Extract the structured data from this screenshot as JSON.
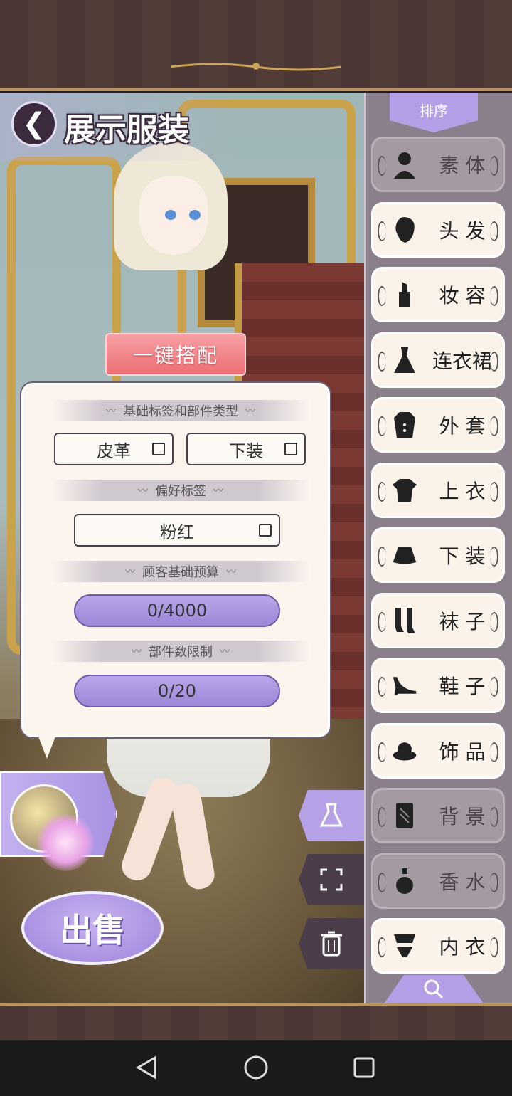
{
  "header": {
    "title": "展示服装",
    "back_glyph": "❮"
  },
  "actions": {
    "one_key_match": "一键搭配",
    "sell": "出售"
  },
  "info_panel": {
    "basic_tags_title": "基础标签和部件类型",
    "basic_tags": [
      "皮革",
      "下装"
    ],
    "preference_title": "偏好标签",
    "preference_tags": [
      "粉红"
    ],
    "budget_title": "顾客基础预算",
    "budget_value": "0/4000",
    "parts_limit_title": "部件数限制",
    "parts_limit_value": "0/20"
  },
  "sidebar": {
    "sort_label": "排序",
    "categories": [
      {
        "label": "素 体",
        "icon": "body-silhouette-icon",
        "enabled": false
      },
      {
        "label": "头 发",
        "icon": "hair-icon",
        "enabled": true
      },
      {
        "label": "妆 容",
        "icon": "lipstick-icon",
        "enabled": true
      },
      {
        "label": "连衣裙",
        "icon": "dress-icon",
        "enabled": true
      },
      {
        "label": "外 套",
        "icon": "coat-icon",
        "enabled": true
      },
      {
        "label": "上 衣",
        "icon": "top-icon",
        "enabled": true
      },
      {
        "label": "下 装",
        "icon": "skirt-icon",
        "enabled": true
      },
      {
        "label": "袜 子",
        "icon": "socks-icon",
        "enabled": true
      },
      {
        "label": "鞋 子",
        "icon": "shoe-icon",
        "enabled": true
      },
      {
        "label": "饰 品",
        "icon": "hat-icon",
        "enabled": true
      },
      {
        "label": "背 景",
        "icon": "background-icon",
        "enabled": false
      },
      {
        "label": "香 水",
        "icon": "perfume-icon",
        "enabled": false
      },
      {
        "label": "内 衣",
        "icon": "lingerie-icon",
        "enabled": true
      }
    ]
  },
  "colors": {
    "accent_purple": "#b49fe6",
    "one_key_pink": "#ec6e74",
    "panel_bg": "#fbf5ee"
  }
}
